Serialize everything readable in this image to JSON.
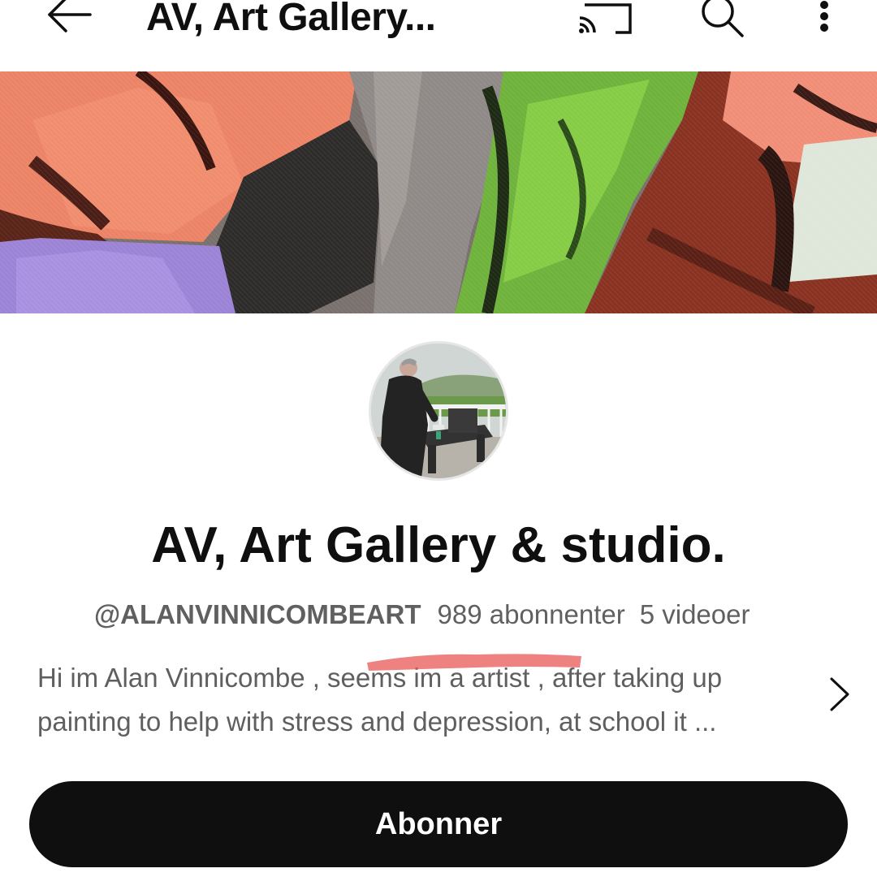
{
  "topbar": {
    "title": "AV, Art Gallery...",
    "back_icon": "arrow-left-icon",
    "cast_icon": "cast-icon",
    "search_icon": "search-icon",
    "more_icon": "more-vert-icon"
  },
  "channel": {
    "name": "AV, Art Gallery & studio.",
    "handle": "@ALANVINNICOMBEART",
    "subscribers": "989 abonnenter",
    "videos": "5 videoer",
    "description_line1": "Hi im Alan Vinnicombe , seems im a artist , after taking up",
    "description_line2": "painting to help with stress and depression,  at school it ...",
    "description_chevron": "chevron-right-icon"
  },
  "actions": {
    "subscribe_label": "Abonner"
  },
  "colors": {
    "background": "#ffffff",
    "text_primary": "#0f0f0f",
    "text_secondary": "#606060",
    "subscribe_bg": "#0f0f0f",
    "subscribe_text": "#ffffff",
    "annotation_red": "#e8524f"
  }
}
